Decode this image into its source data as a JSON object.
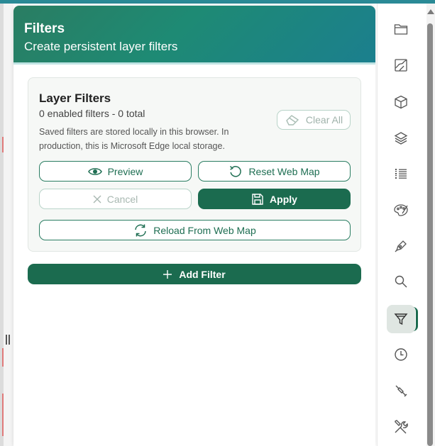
{
  "panel": {
    "title": "Filters",
    "subtitle": "Create persistent layer filters"
  },
  "layer_filters": {
    "title": "Layer Filters",
    "counts": "0 enabled filters - 0 total",
    "note": "Saved filters are stored locally in this browser. In production, this is Microsoft Edge local storage.",
    "clear_all_label": "Clear All",
    "preview_label": "Preview",
    "reset_label": "Reset Web Map",
    "cancel_label": "Cancel",
    "apply_label": "Apply",
    "reload_label": "Reload From Web Map"
  },
  "add_filter_label": "Add Filter",
  "rail": {
    "icons": [
      "folder-icon",
      "map-icon",
      "cube-icon",
      "layers-icon",
      "list-icon",
      "palette-icon",
      "pen-icon",
      "search-icon",
      "filter-icon",
      "clock-icon",
      "tool-icon",
      "wrench-screwdriver-icon"
    ],
    "active": "filter-icon"
  },
  "colors": {
    "accent": "#1b6b4f",
    "header_start": "#2a7d62",
    "header_end": "#1b7f8e"
  }
}
